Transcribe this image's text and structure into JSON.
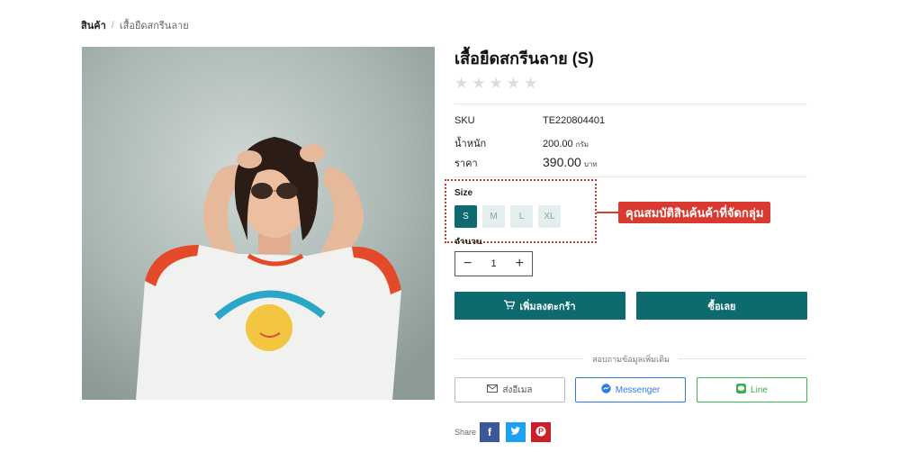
{
  "breadcrumb": {
    "root": "สินค้า",
    "separator": "/",
    "current": "เสื้อยืดสกรีนลาย"
  },
  "product": {
    "title": "เสื้อยืดสกรีนลาย (S)",
    "rating": {
      "filled": 0,
      "max": 5,
      "star_glyph": "★"
    },
    "specs": {
      "sku_label": "SKU",
      "sku_value": "TE220804401",
      "weight_label": "น้ำหนัก",
      "weight_value": "200.00",
      "weight_unit": "กรัม",
      "price_label": "ราคา",
      "price_value": "390.00",
      "price_unit": "บาท"
    },
    "size": {
      "label": "Size",
      "options": [
        "S",
        "M",
        "L",
        "XL"
      ],
      "selected": "S"
    },
    "quantity": {
      "label": "จำนวน",
      "value": "1",
      "minus": "−",
      "plus": "+"
    }
  },
  "annotation": {
    "callout": "คุณสมบัติสินค้นค้าที่จัดกลุ่ม"
  },
  "actions": {
    "add_to_cart": "เพิ่มลงตะกร้า",
    "buy_now": "ซื้อเลย"
  },
  "inquiry": {
    "heading": "สอบถามข้อมูลเพิ่มเติม",
    "email": "ส่งอีเมล",
    "messenger": "Messenger",
    "line": "Line"
  },
  "share": {
    "label": "Share",
    "facebook": "f",
    "pinterest": "P"
  },
  "colors": {
    "primary": "#0d6b6f",
    "callout": "#d9392e",
    "messenger": "#2d7be5",
    "line": "#36b34a",
    "facebook": "#3b5998",
    "twitter": "#1da1f2",
    "pinterest": "#cb2027"
  }
}
